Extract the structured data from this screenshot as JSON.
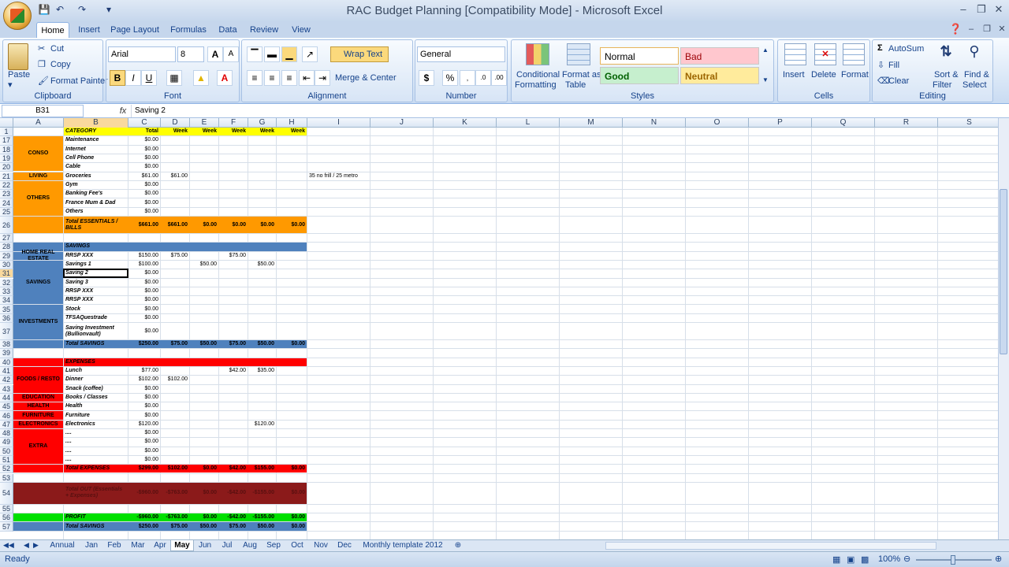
{
  "window": {
    "title": "RAC Budget Planning  [Compatibility Mode] - Microsoft Excel"
  },
  "ribbon_tabs": [
    "Home",
    "Insert",
    "Page Layout",
    "Formulas",
    "Data",
    "Review",
    "View"
  ],
  "ribbon": {
    "clipboard": {
      "label": "Clipboard",
      "paste": "Paste",
      "cut": "Cut",
      "copy": "Copy",
      "format_painter": "Format Painter"
    },
    "font": {
      "label": "Font",
      "name": "Arial",
      "size": "8"
    },
    "alignment": {
      "label": "Alignment",
      "wrap": "Wrap Text",
      "merge": "Merge & Center"
    },
    "number": {
      "label": "Number",
      "format": "General"
    },
    "styles": {
      "label": "Styles",
      "conditional": [
        "Conditional",
        "Formatting"
      ],
      "format_table": [
        "Format as",
        "Table"
      ],
      "normal": "Normal",
      "bad": "Bad",
      "good": "Good",
      "neutral": "Neutral"
    },
    "cells": {
      "label": "Cells",
      "insert": "Insert",
      "delete": "Delete",
      "format": "Format"
    },
    "editing": {
      "label": "Editing",
      "autosum": "AutoSum",
      "fill": "Fill",
      "clear": "Clear",
      "sort": [
        "Sort &",
        "Filter"
      ],
      "find": [
        "Find &",
        "Select"
      ]
    }
  },
  "formula_bar": {
    "name_box": "B31",
    "fx": "fx",
    "content": "Saving 2"
  },
  "columns": [
    "A",
    "B",
    "C",
    "D",
    "E",
    "F",
    "G",
    "H",
    "I",
    "J",
    "K",
    "L",
    "M",
    "N",
    "O",
    "P",
    "Q",
    "R",
    "S"
  ],
  "rows": [
    {
      "n": "1",
      "b": "CATEGORY",
      "c": "Total",
      "d": "Week",
      "e": "Week",
      "f": "Week",
      "g": "Week",
      "h": "Week"
    },
    {
      "n": "17",
      "b": "Maintenance",
      "c": "$0.00"
    },
    {
      "n": "18",
      "b": "Internet",
      "c": "$0.00"
    },
    {
      "n": "19",
      "b": "Cell Phone",
      "c": "$0.00"
    },
    {
      "n": "20",
      "b": "Cable",
      "c": "$0.00"
    },
    {
      "n": "21",
      "b": "Groceries",
      "c": "$61.00",
      "d": "$61.00",
      "i": "35 no frill / 25 metro"
    },
    {
      "n": "22",
      "b": "Gym",
      "c": "$0.00"
    },
    {
      "n": "23",
      "b": "Banking Fee's",
      "c": "$0.00"
    },
    {
      "n": "24",
      "b": "France Mum & Dad",
      "c": "$0.00"
    },
    {
      "n": "25",
      "b": "Others",
      "c": "$0.00"
    },
    {
      "n": "26",
      "b": "Total ESSENTIALS / BILLS",
      "c": "$661.00",
      "d": "$661.00",
      "e": "$0.00",
      "f": "$0.00",
      "g": "$0.00",
      "h": "$0.00"
    },
    {
      "n": "27"
    },
    {
      "n": "28",
      "b": "SAVINGS"
    },
    {
      "n": "29",
      "b": "RRSP XXX",
      "c": "$150.00",
      "d": "$75.00",
      "f": "$75.00"
    },
    {
      "n": "30",
      "b": "Savings  1",
      "c": "$100.00",
      "e": "$50.00",
      "g": "$50.00"
    },
    {
      "n": "31",
      "b": "Saving 2",
      "c": "$0.00"
    },
    {
      "n": "32",
      "b": "Saving 3",
      "c": "$0.00"
    },
    {
      "n": "33",
      "b": "RRSP XXX",
      "c": "$0.00"
    },
    {
      "n": "34",
      "b": "RRSP XXX",
      "c": "$0.00"
    },
    {
      "n": "35",
      "b": "Stock",
      "c": "$0.00"
    },
    {
      "n": "36",
      "b": "TFSAQuestrade",
      "c": "$0.00"
    },
    {
      "n": "37",
      "b": "Saving Investment (Bullionvault)",
      "c": "$0.00"
    },
    {
      "n": "38",
      "b": "Total SAVINGS",
      "c": "$250.00",
      "d": "$75.00",
      "e": "$50.00",
      "f": "$75.00",
      "g": "$50.00",
      "h": "$0.00"
    },
    {
      "n": "39"
    },
    {
      "n": "40",
      "b": "EXPENSES"
    },
    {
      "n": "41",
      "b": "Lunch",
      "c": "$77.00",
      "f": "$42.00",
      "g": "$35.00"
    },
    {
      "n": "42",
      "b": "Dinner",
      "c": "$102.00",
      "d": "$102.00"
    },
    {
      "n": "43",
      "b": "Snack (coffee)",
      "c": "$0.00"
    },
    {
      "n": "44",
      "b": "Books / Classes",
      "c": "$0.00"
    },
    {
      "n": "45",
      "b": "Health",
      "c": "$0.00"
    },
    {
      "n": "46",
      "b": "Furniture",
      "c": "$0.00"
    },
    {
      "n": "47",
      "b": "Electronics",
      "c": "$120.00",
      "g": "$120.00"
    },
    {
      "n": "48",
      "b": "....",
      "c": "$0.00"
    },
    {
      "n": "49",
      "b": "....",
      "c": "$0.00"
    },
    {
      "n": "50",
      "b": "....",
      "c": "$0.00"
    },
    {
      "n": "51",
      "b": "....",
      "c": "$0.00"
    },
    {
      "n": "52",
      "b": "Total EXPENSES",
      "c": "$299.00",
      "d": "$102.00",
      "e": "$0.00",
      "f": "$42.00",
      "g": "$155.00",
      "h": "$0.00"
    },
    {
      "n": "53"
    },
    {
      "n": "54",
      "b": "Total OUT (Essentials + Expenses)",
      "c": "-$960.00",
      "d": "-$763.00",
      "e": "$0.00",
      "f": "-$42.00",
      "g": "-$155.00",
      "h": "$0.00"
    },
    {
      "n": "55"
    },
    {
      "n": "56",
      "b": "PROFIT",
      "c": "-$960.00",
      "d": "-$763.00",
      "e": "$0.00",
      "f": "-$42.00",
      "g": "-$155.00",
      "h": "$0.00"
    },
    {
      "n": "57",
      "b": "Total SAVINGS",
      "c": "$250.00",
      "d": "$75.00",
      "e": "$50.00",
      "f": "$75.00",
      "g": "$50.00",
      "h": "$0.00"
    }
  ],
  "bands": {
    "conso": "CONSO",
    "living": "LIVING",
    "others": "OTHERS",
    "home": "HOME REAL ESTATE",
    "savings": "SAVINGS",
    "investments": "INVESTMENTS",
    "foods": "FOODS / RESTO",
    "education": "EDUCATION",
    "health": "HEALTH",
    "furniture": "FURNITURE",
    "electronics": "ELECTRONICS",
    "extra": "EXTRA"
  },
  "sheet_tabs": [
    "Annual",
    "Jan",
    "Feb",
    "Mar",
    "Apr",
    "May",
    "Jun",
    "Jul",
    "Aug",
    "Sep",
    "Oct",
    "Nov",
    "Dec",
    "Monthly template 2012"
  ],
  "active_sheet": "May",
  "status": {
    "ready": "Ready",
    "zoom": "100%"
  },
  "colors": {
    "orange": "#ff9900",
    "blue": "#4f81bd",
    "red": "#ff0000",
    "green": "#00e000",
    "darkred": "#8b1a1a",
    "yellow": "#ffff00"
  }
}
